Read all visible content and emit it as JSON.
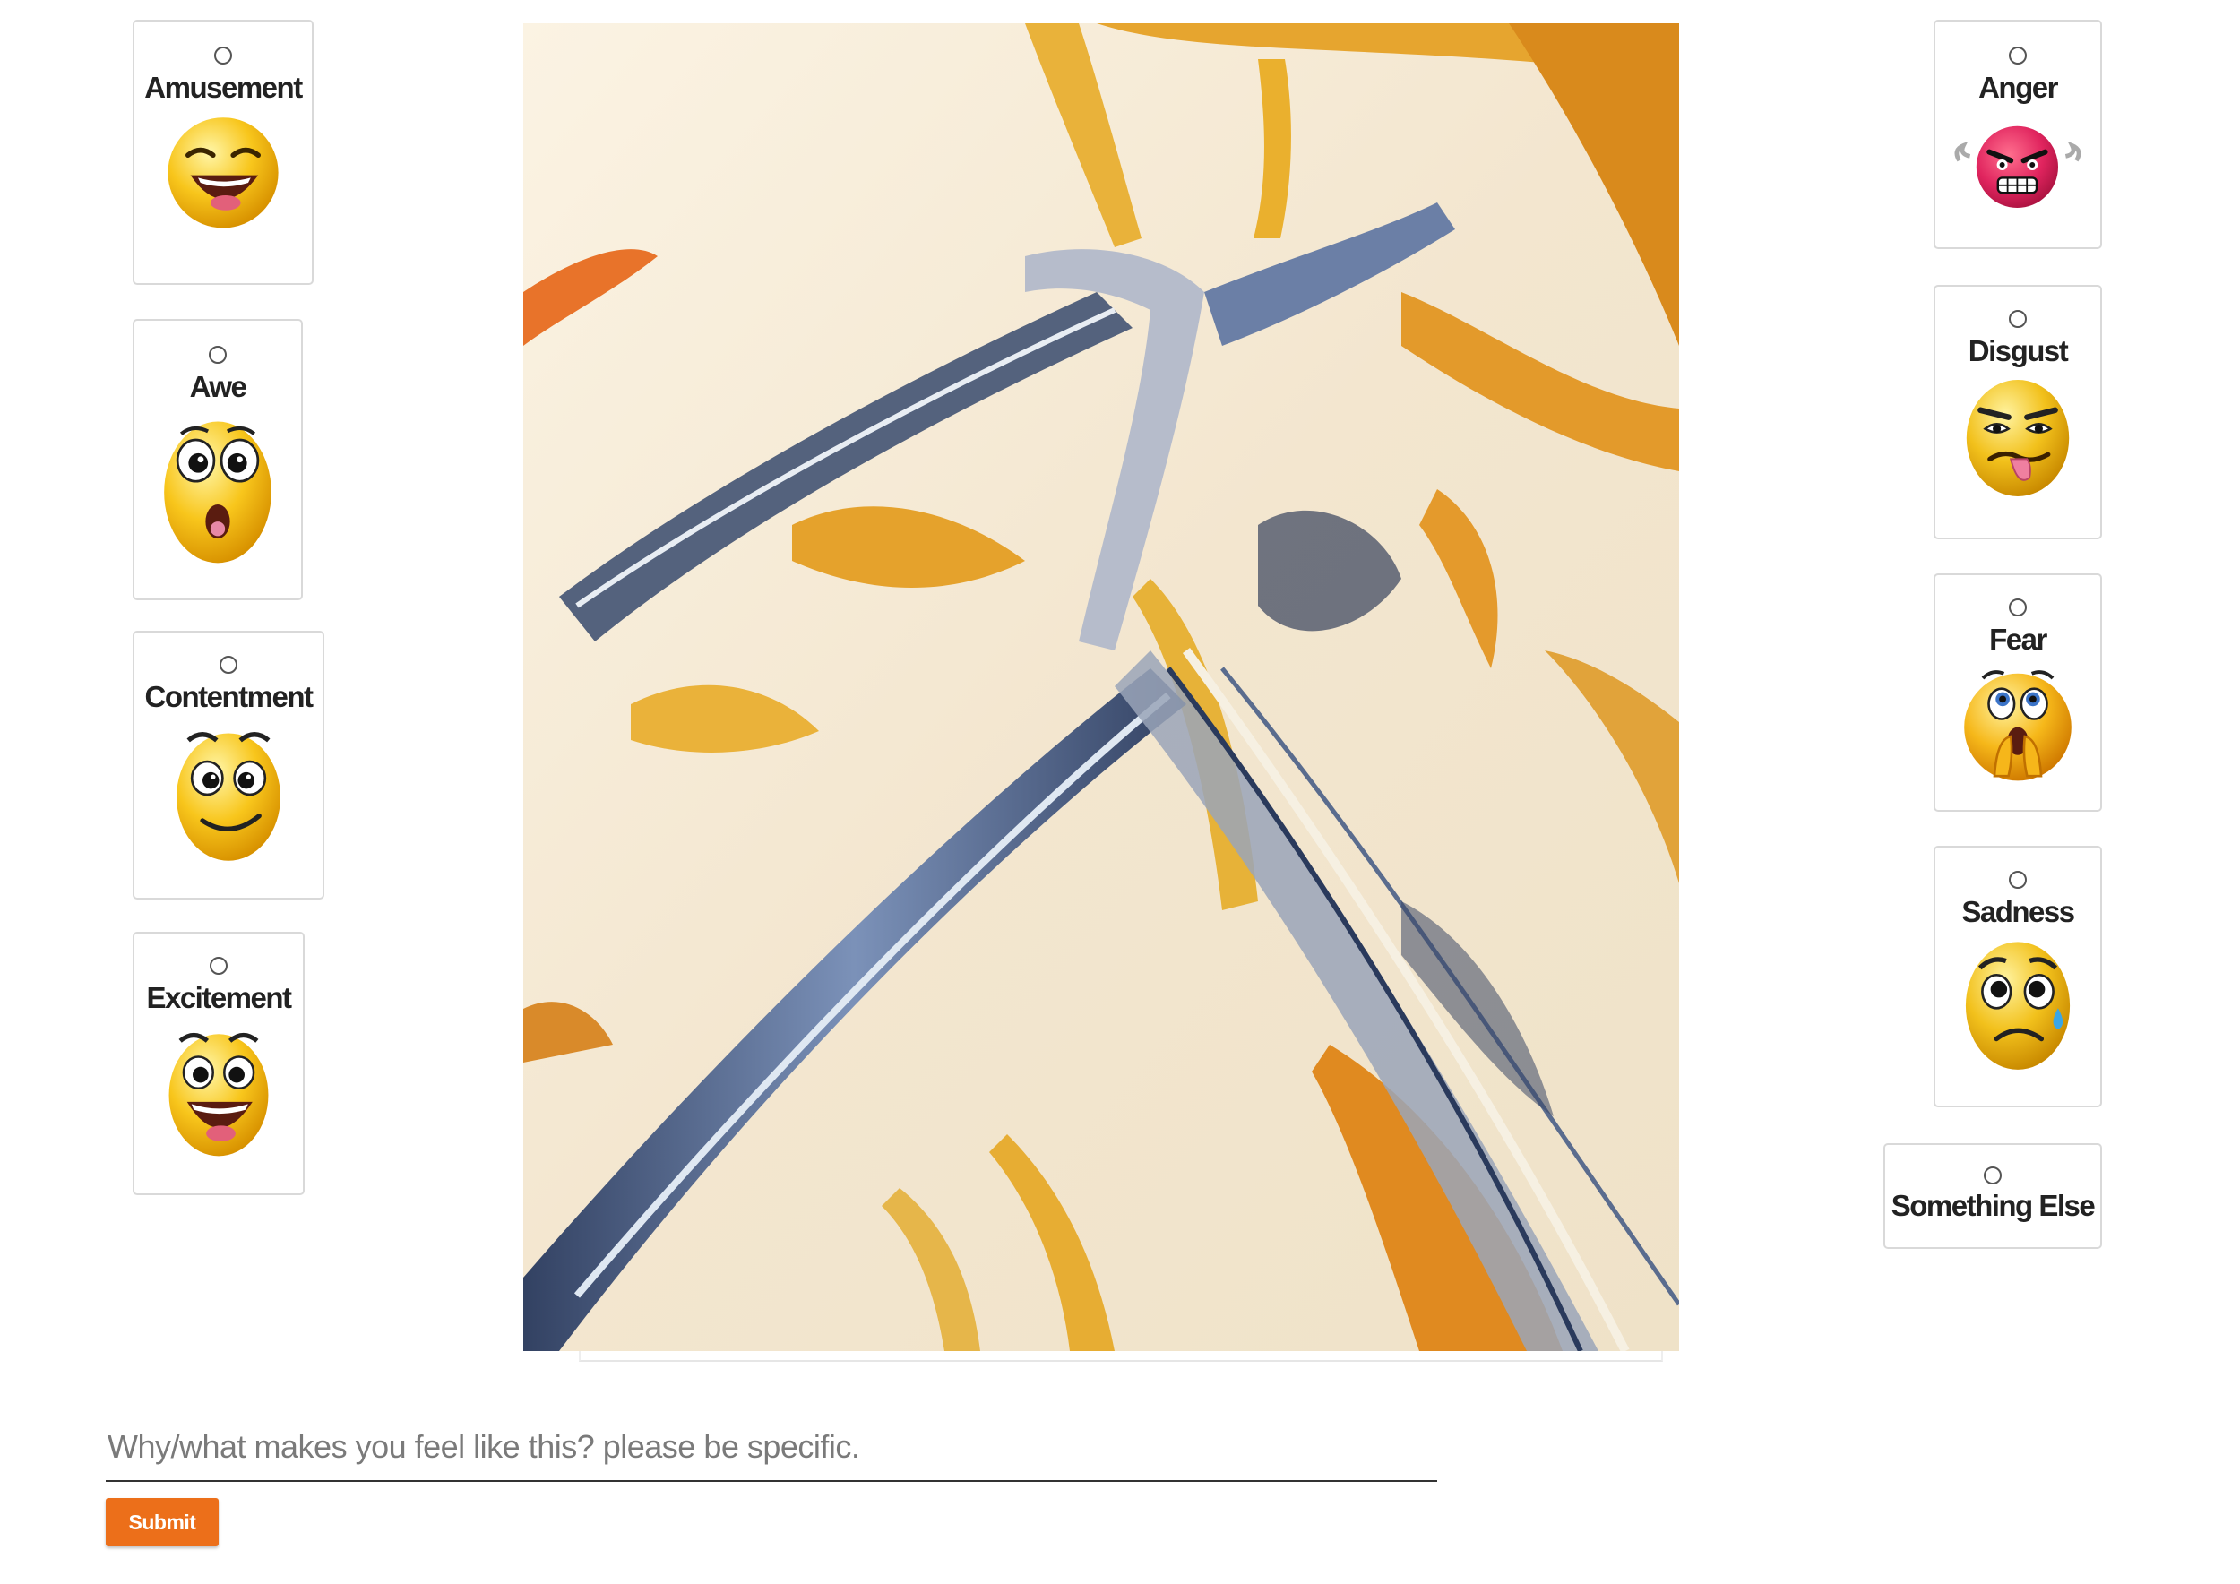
{
  "emotions_left": [
    {
      "label": "Amusement"
    },
    {
      "label": "Awe"
    },
    {
      "label": "Contentment"
    },
    {
      "label": "Excitement"
    }
  ],
  "emotions_right": [
    {
      "label": "Anger"
    },
    {
      "label": "Disgust"
    },
    {
      "label": "Fear"
    },
    {
      "label": "Sadness"
    },
    {
      "label": "Something Else"
    }
  ],
  "comment": {
    "placeholder": "Why/what makes you feel like this? please be specific.",
    "value": ""
  },
  "submit_label": "Submit",
  "colors": {
    "accent": "#ec6f1a",
    "card_border": "#d9d9d9",
    "emoji_yellow": "#f5c518",
    "anger_red": "#e0245e"
  }
}
